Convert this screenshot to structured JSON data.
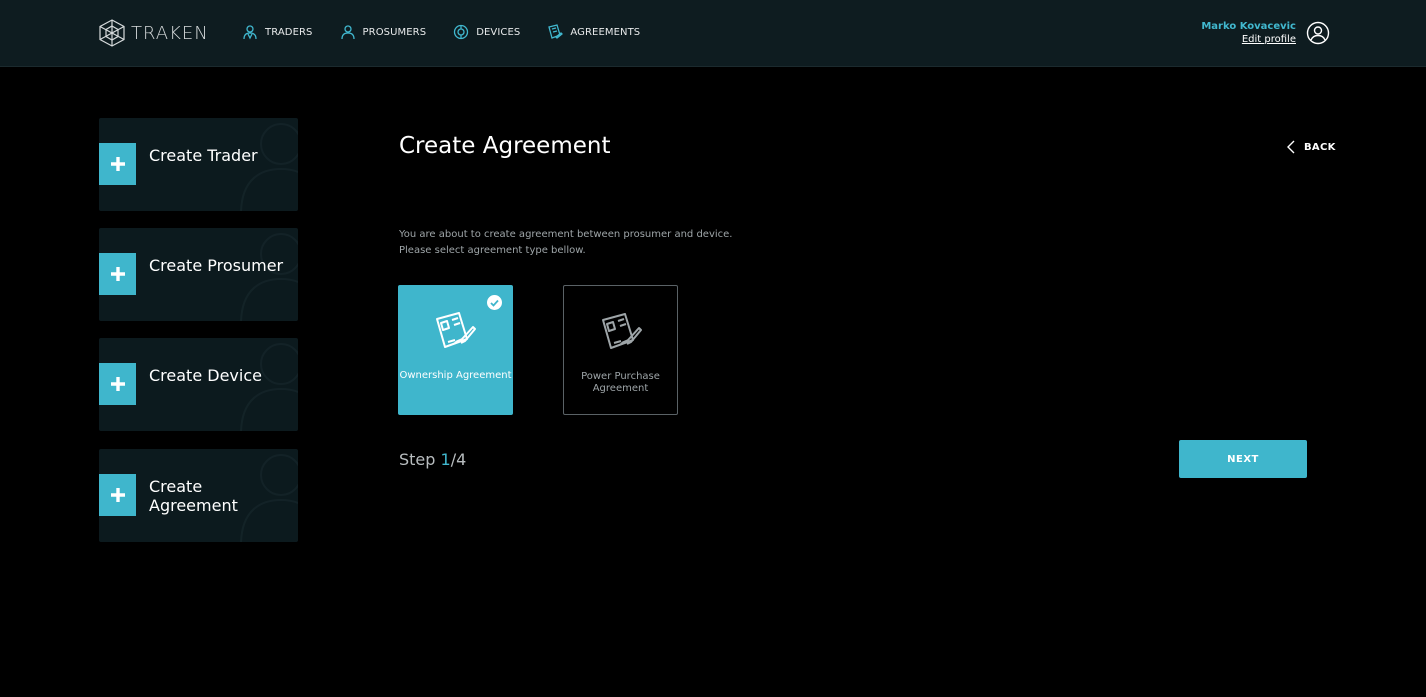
{
  "header": {
    "logo_text": "TRAKEN",
    "nav": [
      {
        "label": "TRADERS",
        "icon": "trader-icon"
      },
      {
        "label": "PROSUMERS",
        "icon": "prosumer-icon"
      },
      {
        "label": "DEVICES",
        "icon": "device-icon"
      },
      {
        "label": "AGREEMENTS",
        "icon": "agreement-icon"
      }
    ],
    "user": {
      "name": "Marko Kovacevic",
      "edit_label": "Edit profile"
    }
  },
  "sidebar": {
    "items": [
      {
        "label": "Create Trader"
      },
      {
        "label": "Create Prosumer"
      },
      {
        "label": "Create Device"
      },
      {
        "label": "Create Agreement"
      }
    ]
  },
  "main": {
    "title": "Create Agreement",
    "back_label": "BACK",
    "description_line1": "You are about to create agreement between prosumer and device.",
    "description_line2": "Please select agreement type bellow.",
    "options": [
      {
        "label": "Ownership Agreement",
        "selected": true
      },
      {
        "label": "Power Purchase Agreement",
        "selected": false
      }
    ],
    "step_prefix": "Step ",
    "step_current": "1",
    "step_total": "/4",
    "next_label": "NEXT"
  },
  "colors": {
    "accent": "#3fb6cc",
    "header_bg": "#0e1c20",
    "card_bg": "#0c1a1e",
    "page_bg": "#000000"
  }
}
